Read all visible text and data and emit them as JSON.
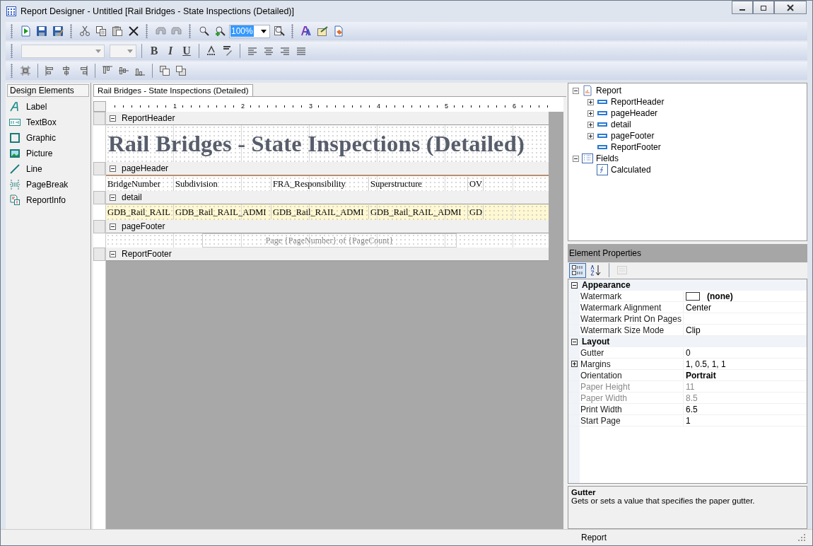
{
  "window": {
    "title": "Report Designer - Untitled [Rail Bridges - State Inspections (Detailed)]"
  },
  "toolbar": {
    "zoom": "100%",
    "zoom_selected": true,
    "format_buttons": [
      {
        "label": "B",
        "kind": "bold"
      },
      {
        "label": "I",
        "kind": "italic"
      },
      {
        "label": "U",
        "kind": "underline"
      }
    ]
  },
  "design_elements": {
    "title": "Design Elements",
    "items": [
      {
        "label": "Label",
        "kind": "label"
      },
      {
        "label": "TextBox",
        "kind": "textbox"
      },
      {
        "label": "Graphic",
        "kind": "graphic"
      },
      {
        "label": "Picture",
        "kind": "picture"
      },
      {
        "label": "Line",
        "kind": "line"
      },
      {
        "label": "PageBreak",
        "kind": "pagebreak"
      },
      {
        "label": "ReportInfo",
        "kind": "reportinfo"
      }
    ]
  },
  "document_tab": {
    "label": "Rail Bridges - State Inspections (Detailed)",
    "selected": true
  },
  "ruler": {
    "marks": [
      "1",
      "2",
      "3",
      "4",
      "5",
      "6"
    ]
  },
  "sections": [
    {
      "name": "ReportHeader",
      "kind": "title",
      "text": "Rail Bridges - State Inspections (Detailed)"
    },
    {
      "name": "pageHeader",
      "kind": "fields",
      "highlight": false,
      "cells": [
        "BridgeNumber",
        "Subdivision",
        "FRA_Responsibility",
        "Superstructure",
        "OV"
      ]
    },
    {
      "name": "detail",
      "kind": "fields",
      "highlight": true,
      "cells": [
        "GDB_Rail_RAIL",
        "GDB_Rail_RAIL_ADMI",
        "GDB_Rail_RAIL_ADMI",
        "GDB_Rail_RAIL_ADMI",
        "GD"
      ]
    },
    {
      "name": "pageFooter",
      "kind": "footer",
      "text": "Page {PageNumber} of {PageCount}"
    },
    {
      "name": "ReportFooter",
      "kind": "empty"
    }
  ],
  "report_tree": [
    {
      "label": "Report",
      "kind": "report",
      "expanded": true,
      "children": [
        {
          "label": "ReportHeader",
          "kind": "section",
          "expanded": false
        },
        {
          "label": "pageHeader",
          "kind": "section",
          "expanded": false
        },
        {
          "label": "detail",
          "kind": "section",
          "expanded": false
        },
        {
          "label": "pageFooter",
          "kind": "section",
          "expanded": false
        },
        {
          "label": "ReportFooter",
          "kind": "section"
        }
      ]
    },
    {
      "label": "Fields",
      "kind": "fields",
      "expanded": true,
      "children": [
        {
          "label": "Calculated",
          "kind": "field"
        }
      ]
    }
  ],
  "properties": {
    "title": "Element Properties",
    "view_buttons": [
      {
        "kind": "categorized",
        "selected": true
      },
      {
        "kind": "alphabetical",
        "selected": false
      },
      {
        "kind": "pages",
        "selected": false,
        "disabled": true
      }
    ],
    "categories": [
      {
        "name": "Appearance",
        "expanded": true,
        "rows": [
          {
            "name": "Watermark",
            "value": "(none)",
            "kind": "swatch",
            "bold": true,
            "disabled": false
          },
          {
            "name": "Watermark Alignment",
            "value": "Center",
            "bold": false,
            "disabled": false
          },
          {
            "name": "Watermark Print On Pages",
            "disabled": false
          },
          {
            "name": "Watermark Size Mode",
            "value": "Clip",
            "bold": false,
            "disabled": false
          }
        ]
      },
      {
        "name": "Layout",
        "expanded": true,
        "rows": [
          {
            "name": "Gutter",
            "value": "0",
            "bold": false,
            "disabled": false
          },
          {
            "name": "Margins",
            "value": "1, 0.5, 1, 1",
            "expanded": false,
            "bold": false,
            "disabled": false
          },
          {
            "name": "Orientation",
            "value": "Portrait",
            "bold": true,
            "disabled": false
          },
          {
            "name": "Paper Height",
            "value": "11",
            "bold": false,
            "disabled": true
          },
          {
            "name": "Paper Width",
            "value": "8.5",
            "bold": false,
            "disabled": true
          },
          {
            "name": "Print Width",
            "value": "6.5",
            "bold": false,
            "disabled": false
          },
          {
            "name": "Start Page",
            "value": "1",
            "bold": false,
            "disabled": false
          }
        ]
      }
    ],
    "description": {
      "title": "Gutter",
      "text": "Gets or sets a value that specifies the paper gutter."
    }
  },
  "status_bar": {
    "text": "Report"
  }
}
